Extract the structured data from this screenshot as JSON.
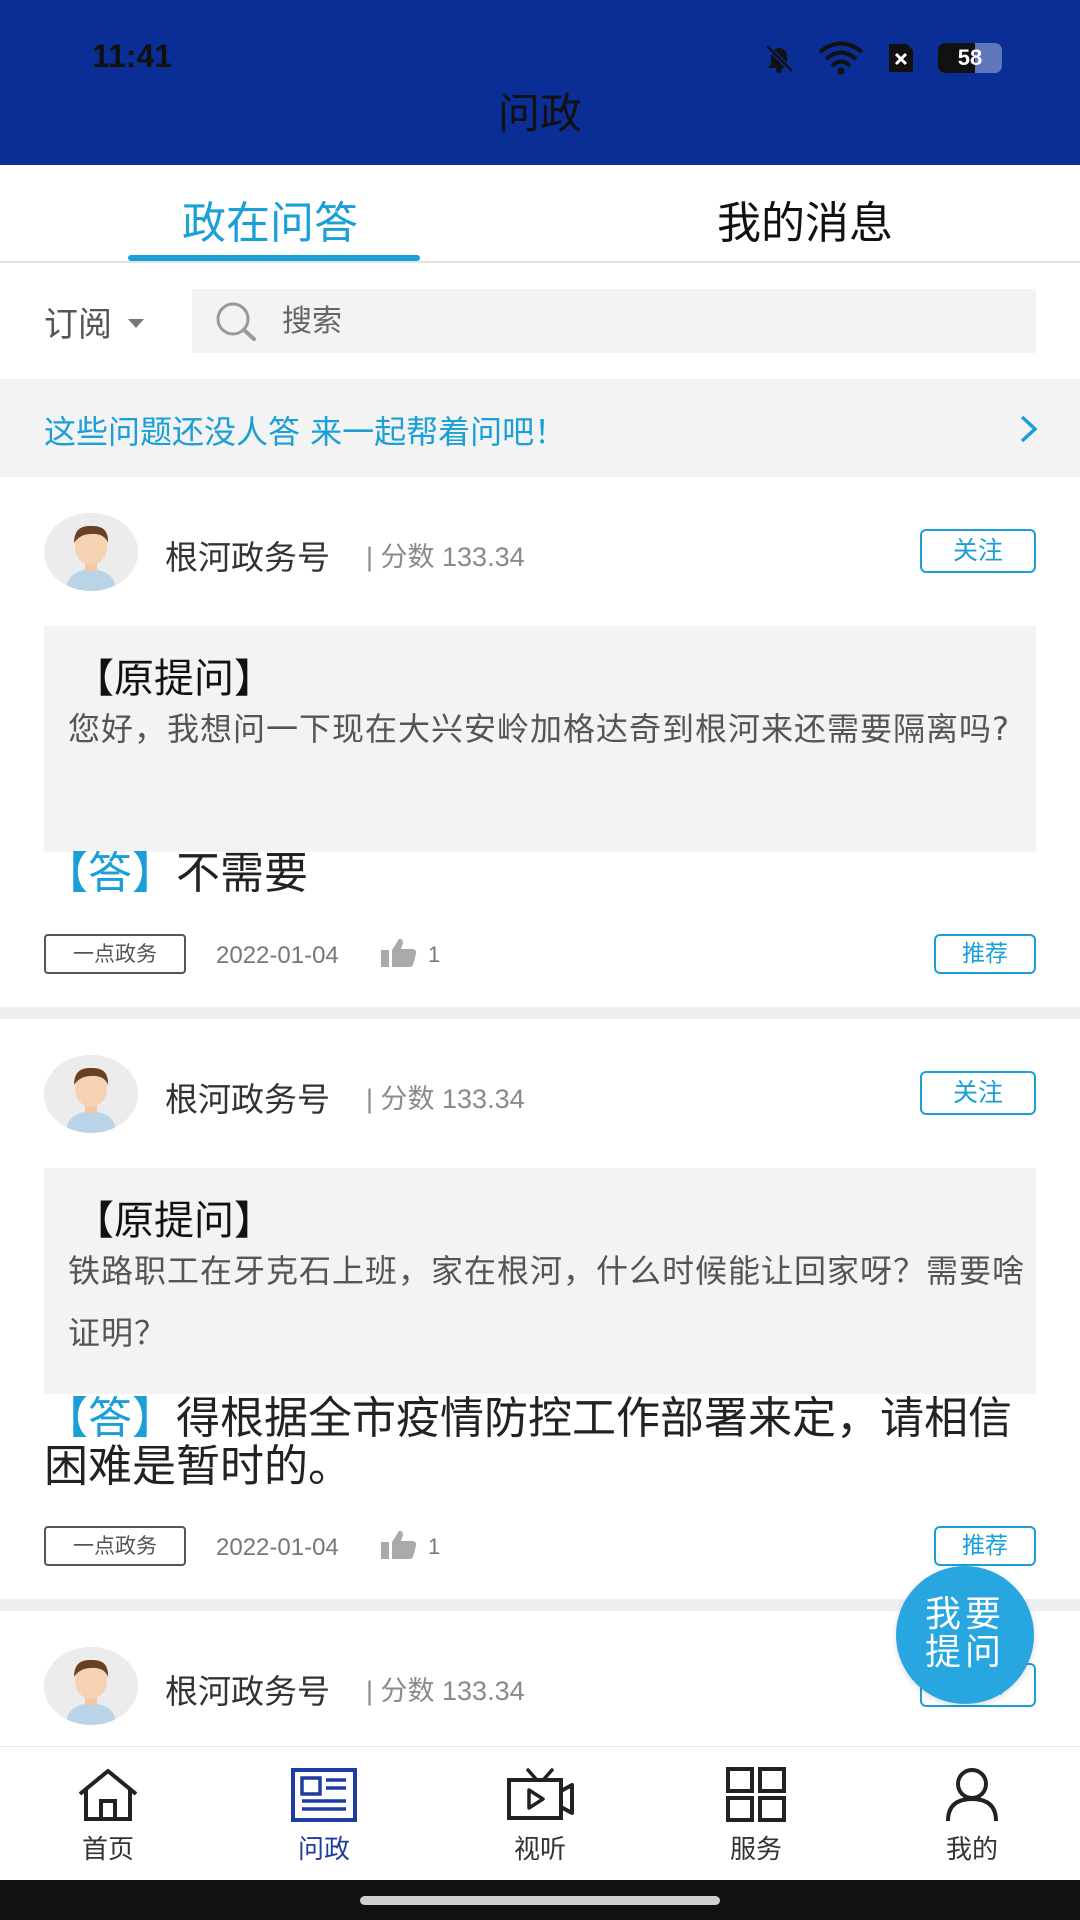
{
  "status_bar": {
    "time": "11:41",
    "battery": "58"
  },
  "header": {
    "title": "问政"
  },
  "tabs": [
    {
      "label": "政在问答",
      "active": true
    },
    {
      "label": "我的消息",
      "active": false
    }
  ],
  "filter": {
    "subscribe_label": "订阅",
    "search_placeholder": "搜索"
  },
  "banner": {
    "text": "这些问题还没人答 来一起帮着问吧！"
  },
  "cards": [
    {
      "author": "根河政务号",
      "score": "| 分数 133.34",
      "follow_label": "关注",
      "question_title": "【原提问】",
      "question_body": "您好，我想问一下现在大兴安岭加格达奇到根河来还需要隔离吗?",
      "answer_tag": "【答】",
      "answer_text": "不需要",
      "source": "一点政务",
      "date": "2022-01-04",
      "likes": "1",
      "recommend_label": "推荐"
    },
    {
      "author": "根河政务号",
      "score": "| 分数 133.34",
      "follow_label": "关注",
      "question_title": "【原提问】",
      "question_body": "铁路职工在牙克石上班，家在根河，什么时候能让回家呀？需要啥证明？",
      "answer_tag": "【答】",
      "answer_text": "得根据全市疫情防控工作部署来定，请相信困难是暂时的。",
      "source": "一点政务",
      "date": "2022-01-04",
      "likes": "1",
      "recommend_label": "推荐"
    },
    {
      "author": "根河政务号",
      "score": "| 分数 133.34",
      "follow_label": "关注"
    }
  ],
  "fab": {
    "line1": "我要",
    "line2": "提问"
  },
  "bottom_nav": [
    {
      "label": "首页",
      "icon": "home-icon"
    },
    {
      "label": "问政",
      "icon": "news-icon",
      "active": true
    },
    {
      "label": "视听",
      "icon": "tv-icon"
    },
    {
      "label": "服务",
      "icon": "grid-icon"
    },
    {
      "label": "我的",
      "icon": "user-icon"
    }
  ],
  "colors": {
    "header_bg": "#0a2d96",
    "accent": "#1a9fd6",
    "nav_active": "#1f3d9e",
    "fab": "#27a6e0"
  }
}
